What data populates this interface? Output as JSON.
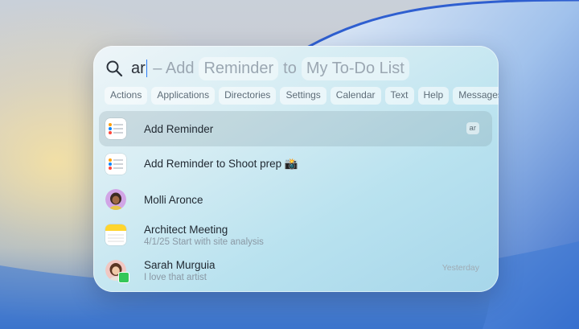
{
  "search": {
    "query": "ar",
    "suggestion_prefix": "– Add",
    "suggestion_token_1": "Reminder",
    "suggestion_joiner": "to",
    "suggestion_token_2": "My To-Do List"
  },
  "categories": [
    "Actions",
    "Applications",
    "Directories",
    "Settings",
    "Calendar",
    "Text",
    "Help",
    "Messages"
  ],
  "results": [
    {
      "title": "Add Reminder",
      "subtitle": "",
      "trailing": "ar",
      "icon": "reminders-icon",
      "selected": true
    },
    {
      "title": "Add Reminder to Shoot prep 📸",
      "subtitle": "",
      "trailing": "",
      "icon": "reminders-icon",
      "selected": false
    },
    {
      "title": "Molli Aronce",
      "subtitle": "",
      "trailing": "",
      "icon": "contact-avatar-icon",
      "selected": false
    },
    {
      "title": "Architect Meeting",
      "subtitle": "4/1/25 Start with site analysis",
      "trailing": "",
      "icon": "notes-icon",
      "selected": false
    },
    {
      "title": "Sarah Murguia",
      "subtitle": "I love that artist",
      "trailing": "Yesterday",
      "icon": "contact-avatar-icon",
      "selected": false
    }
  ],
  "colors": {
    "caret": "#2a7cf6",
    "selection": "#8c9aa3"
  }
}
